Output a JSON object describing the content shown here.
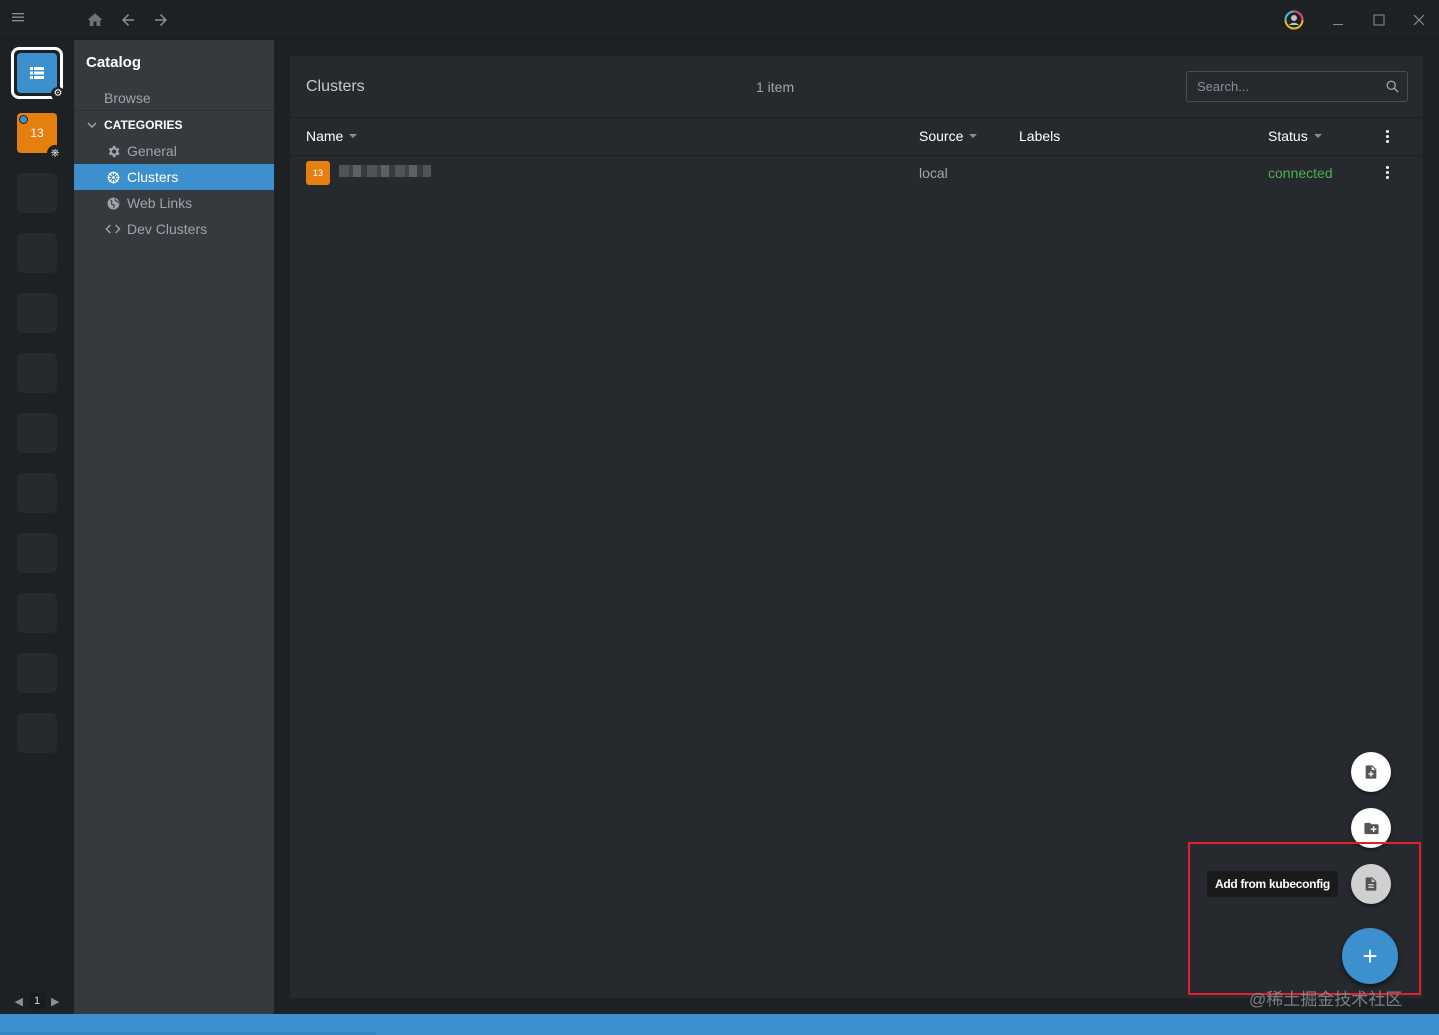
{
  "window": {
    "controls": [
      "menu-icon",
      "home-icon",
      "back-icon",
      "forward-icon",
      "user-icon",
      "minimize-icon",
      "maximize-icon",
      "close-icon"
    ]
  },
  "hotbar": {
    "cluster_label": "13",
    "page": "1"
  },
  "sidebar": {
    "title": "Catalog",
    "browse": "Browse",
    "categories_label": "CATEGORIES",
    "items": [
      {
        "label": "General",
        "icon": "gear-icon"
      },
      {
        "label": "Clusters",
        "icon": "kubernetes-icon"
      },
      {
        "label": "Web Links",
        "icon": "globe-icon"
      },
      {
        "label": "Dev Clusters",
        "icon": "code-icon"
      }
    ]
  },
  "main": {
    "title": "Clusters",
    "count": "1 item",
    "search_placeholder": "Search...",
    "columns": {
      "name": "Name",
      "source": "Source",
      "labels": "Labels",
      "status": "Status"
    },
    "rows": [
      {
        "badge": "13",
        "source": "local",
        "status": "connected"
      }
    ]
  },
  "fab": {
    "tooltip": "Add from kubeconfig",
    "plus": "+"
  },
  "watermark": "@稀土掘金技术社区",
  "colors": {
    "accent": "#3d90ce",
    "cluster_badge": "#e5800f",
    "status_connected": "#4caf50",
    "highlight": "#e0202a"
  }
}
